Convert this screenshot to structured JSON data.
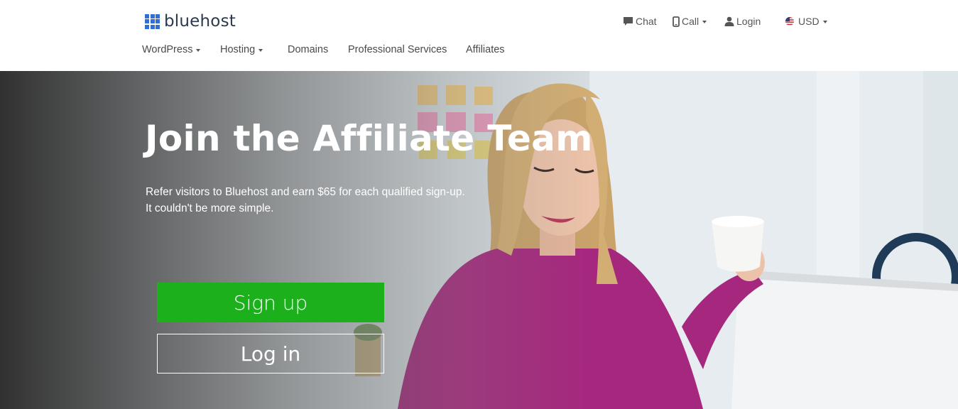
{
  "brand": {
    "name": "bluehost",
    "logo_color": "#2f6fd6"
  },
  "utility_nav": {
    "chat_label": "Chat",
    "call_label": "Call",
    "login_label": "Login",
    "currency_label": "USD"
  },
  "main_nav": {
    "items": [
      {
        "label": "WordPress",
        "has_dropdown": true
      },
      {
        "label": "Hosting",
        "has_dropdown": true
      },
      {
        "label": "Domains",
        "has_dropdown": false
      },
      {
        "label": "Professional Services",
        "has_dropdown": false
      },
      {
        "label": "Affiliates",
        "has_dropdown": false
      }
    ]
  },
  "hero": {
    "title": "Join the Affiliate Team",
    "subtitle_line1": "Refer visitors to Bluehost and earn $65 for each qualified sign-up.",
    "subtitle_line2": "It couldn't be more simple.",
    "signup_label": "Sign up",
    "login_label": "Log in",
    "signup_color": "#1db01d"
  },
  "icons": {
    "chat": "chat-bubble-icon",
    "call": "phone-icon",
    "login": "user-icon",
    "currency": "us-flag-icon"
  }
}
